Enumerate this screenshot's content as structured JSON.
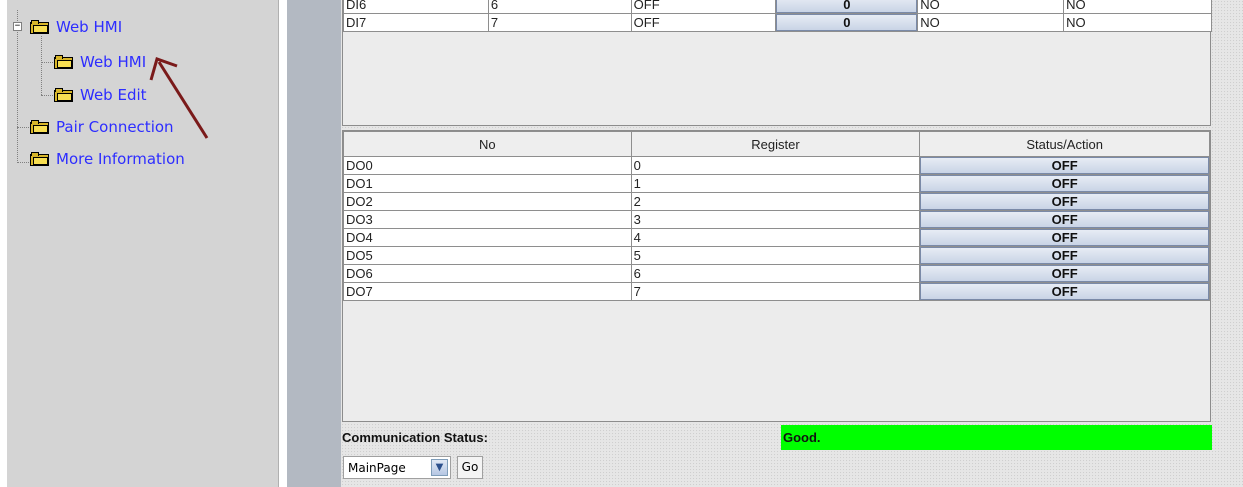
{
  "tree": {
    "items": [
      {
        "label": "Web HMI"
      },
      {
        "label": "Web HMI"
      },
      {
        "label": "Web Edit"
      },
      {
        "label": "Pair Connection"
      },
      {
        "label": "More Information"
      }
    ]
  },
  "di_table": {
    "rows": [
      {
        "no": "DI6",
        "register": "6",
        "state": "OFF",
        "value": "0",
        "col5": "NO",
        "col6": "NO"
      },
      {
        "no": "DI7",
        "register": "7",
        "state": "OFF",
        "value": "0",
        "col5": "NO",
        "col6": "NO"
      }
    ]
  },
  "do_table": {
    "headers": [
      "No",
      "Register",
      "Status/Action"
    ],
    "rows": [
      {
        "no": "DO0",
        "register": "0",
        "action": "OFF"
      },
      {
        "no": "DO1",
        "register": "1",
        "action": "OFF"
      },
      {
        "no": "DO2",
        "register": "2",
        "action": "OFF"
      },
      {
        "no": "DO3",
        "register": "3",
        "action": "OFF"
      },
      {
        "no": "DO4",
        "register": "4",
        "action": "OFF"
      },
      {
        "no": "DO5",
        "register": "5",
        "action": "OFF"
      },
      {
        "no": "DO6",
        "register": "6",
        "action": "OFF"
      },
      {
        "no": "DO7",
        "register": "7",
        "action": "OFF"
      }
    ]
  },
  "communication": {
    "label": "Communication Status:",
    "status": "Good.",
    "status_color": "#00ff00"
  },
  "footer": {
    "page_select_value": "MainPage",
    "go_label": "Go"
  },
  "icons": {
    "tree_folder": "folder-icon",
    "tree_expander": "collapse-icon",
    "select_arrow": "chevron-down-icon",
    "pointer": "arrow-annotation-icon"
  },
  "colors": {
    "tree_bg": "#d4d4d4",
    "tree_link": "#2d2dff",
    "gutter": "#b3b9c2",
    "button_gradient_top": "#e7ecf5",
    "button_gradient_bottom": "#c9d4e6"
  }
}
